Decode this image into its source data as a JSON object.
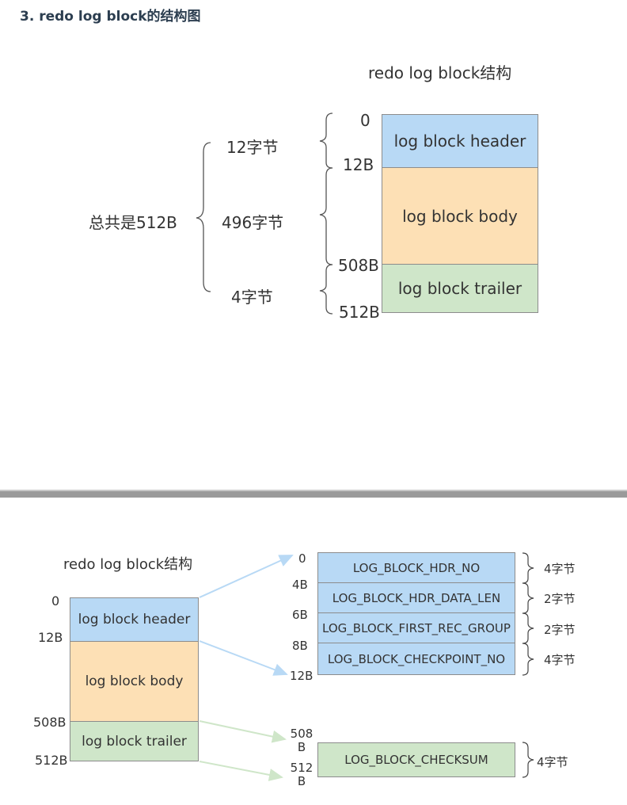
{
  "heading": "3. redo log block的结构图",
  "top": {
    "title": "redo log block结构",
    "total_label": "总共是512B",
    "segment_sizes": [
      "12字节",
      "496字节",
      "4字节"
    ],
    "offsets": [
      "0",
      "12B",
      "508B",
      "512B"
    ],
    "blocks": [
      "log block header",
      "log block body",
      "log block trailer"
    ]
  },
  "bottom": {
    "title": "redo log block结构",
    "offsets": [
      "0",
      "12B",
      "508B",
      "512B"
    ],
    "blocks": [
      "log block header",
      "log block body",
      "log block trailer"
    ],
    "header_offsets": [
      "0",
      "4B",
      "6B",
      "8B",
      "12B"
    ],
    "header_fields": [
      "LOG_BLOCK_HDR_NO",
      "LOG_BLOCK_HDR_DATA_LEN",
      "LOG_BLOCK_FIRST_REC_GROUP",
      "LOG_BLOCK_CHECKPOINT_NO"
    ],
    "header_sizes": [
      "4字节",
      "2字节",
      "2字节",
      "4字节"
    ],
    "trailer_offsets": [
      "508\nB",
      "512\nB"
    ],
    "trailer_offset_parts": [
      [
        "508",
        "B"
      ],
      [
        "512",
        "B"
      ]
    ],
    "trailer_field": "LOG_BLOCK_CHECKSUM",
    "trailer_size": "4字节"
  },
  "colors": {
    "header": "#b8d9f5",
    "body": "#fde0b5",
    "trailer": "#cfe6c9",
    "arrow_blue": "#b8d9f5",
    "arrow_green": "#cfe6c9"
  }
}
